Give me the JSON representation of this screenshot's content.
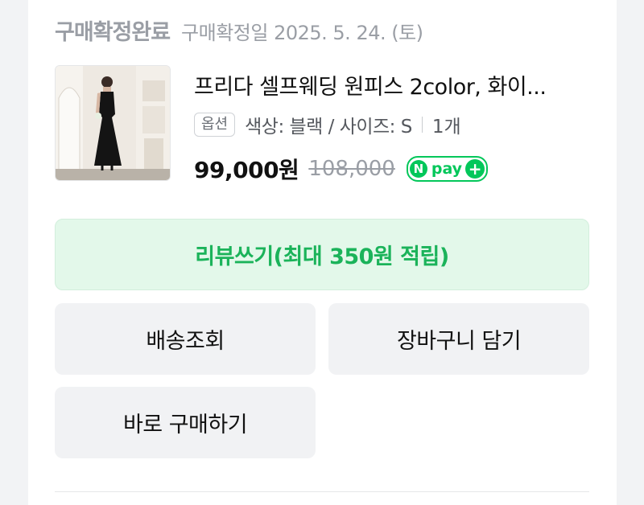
{
  "order": {
    "status": "구매확정완료",
    "date_text": "구매확정일 2025. 5. 24. (토)"
  },
  "product": {
    "name": "프리다 셀프웨딩 원피스 2color, 화이...",
    "option_badge": "옵션",
    "option_text": "색상: 블랙 / 사이즈: S",
    "quantity": "1개",
    "price": "99,000원",
    "original_price": "108,000",
    "npay_n": "N",
    "npay_word": "pay",
    "npay_plus": "+",
    "image_icon": "product-photo-black-dress"
  },
  "actions": {
    "review": "리뷰쓰기(최대 350원 적립)",
    "tracking": "배송조회",
    "cart": "장바구니 담기",
    "buy_again": "바로 구매하기"
  },
  "colors": {
    "accent_green": "#03c75a",
    "review_bg": "#e3f8ea",
    "review_text": "#1bb35a"
  }
}
